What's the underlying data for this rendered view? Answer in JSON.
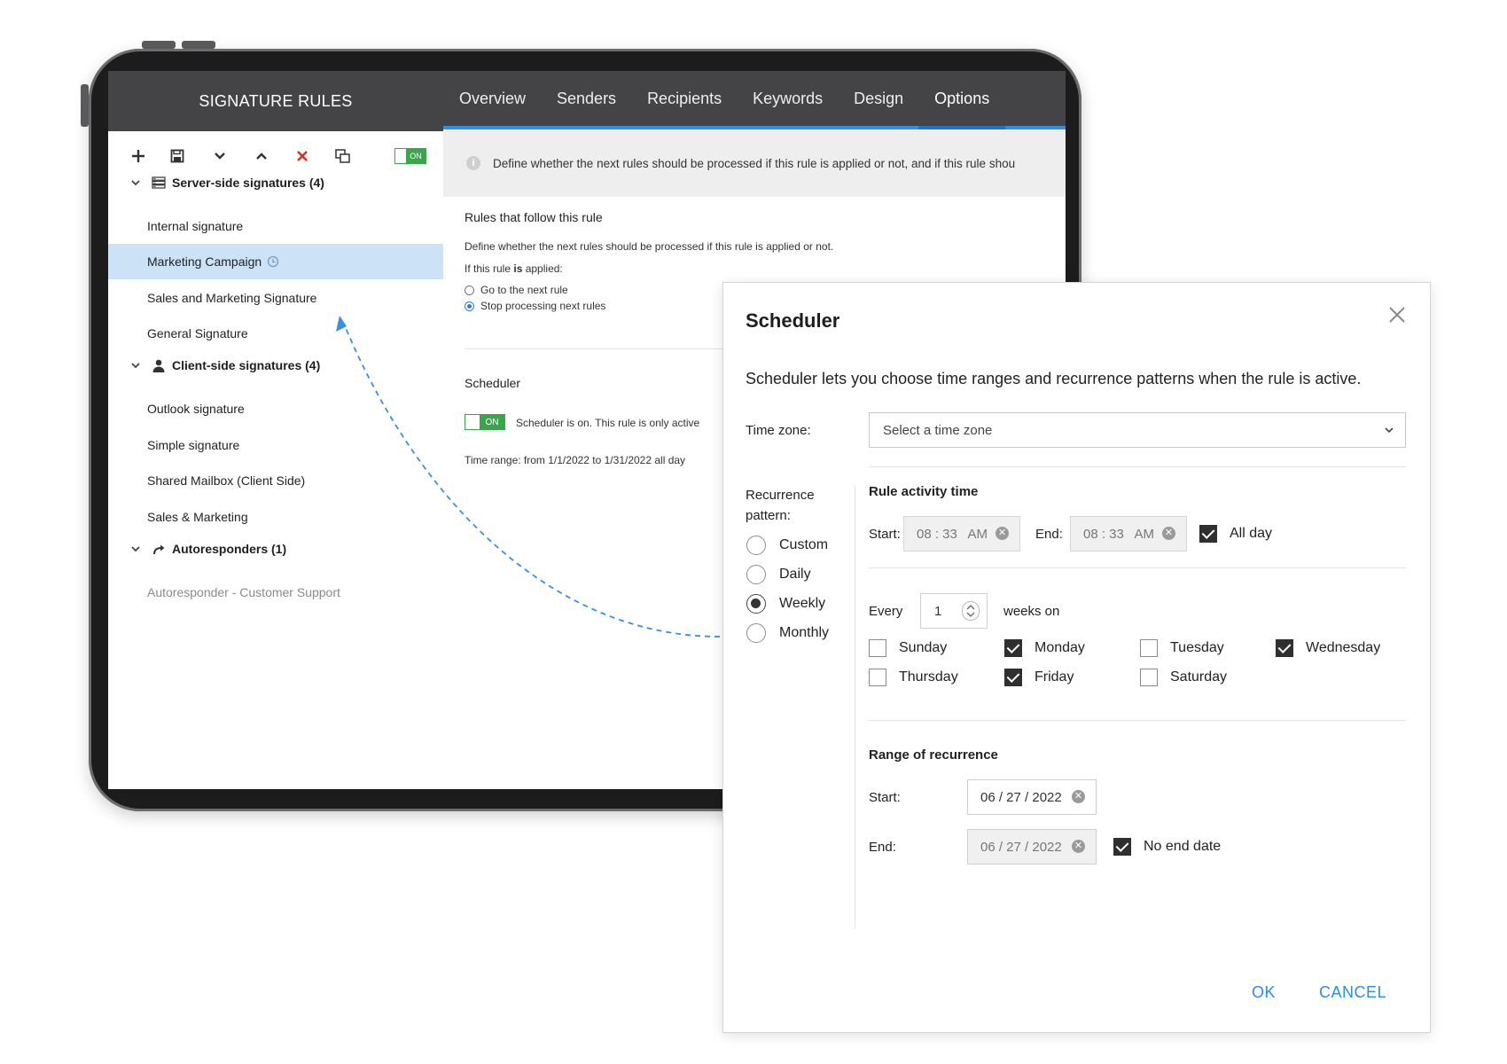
{
  "sidebar": {
    "title": "SIGNATURE RULES",
    "toolbar": {
      "toggle_label": "ON"
    },
    "groups": [
      {
        "label": "Server-side signatures (4)",
        "icon": "server-icon",
        "items": [
          "Internal signature",
          "Marketing Campaign",
          "Sales and Marketing Signature",
          "General Signature"
        ]
      },
      {
        "label": "Client-side signatures (4)",
        "icon": "person-icon",
        "items": [
          "Outlook signature",
          "Simple signature",
          "Shared Mailbox (Client Side)",
          "Sales & Marketing"
        ]
      },
      {
        "label": "Autoresponders (1)",
        "icon": "reply-arrow-icon",
        "items": [
          "Autoresponder - Customer Support"
        ]
      }
    ],
    "selected_item": "Marketing Campaign"
  },
  "tabs": [
    "Overview",
    "Senders",
    "Recipients",
    "Keywords",
    "Design",
    "Options"
  ],
  "active_tab": "Options",
  "options": {
    "info_text": "Define whether the next rules should be processed if this rule is applied or not, and if this rule shou",
    "rules_follow_title": "Rules that follow this rule",
    "rules_follow_desc": "Define whether the next rules should be processed if this rule is applied or not.",
    "if_applied_prefix": "If this rule ",
    "if_applied_bold": "is",
    "if_applied_suffix": " applied:",
    "radio_next": "Go to the next rule",
    "radio_stop": "Stop processing next rules",
    "scheduler_title": "Scheduler",
    "scheduler_toggle": "ON",
    "scheduler_status": "Scheduler is on. This rule is only active",
    "time_range": "Time range: from 1/1/2022 to 1/31/2022 all day"
  },
  "dialog": {
    "title": "Scheduler",
    "description": "Scheduler lets you choose time ranges and recurrence patterns when the rule is active.",
    "timezone_label": "Time zone:",
    "timezone_placeholder": "Select a time zone",
    "recurrence_label_1": "Recurrence",
    "recurrence_label_2": "pattern:",
    "patterns": [
      "Custom",
      "Daily",
      "Weekly",
      "Monthly"
    ],
    "selected_pattern": "Weekly",
    "activity_title": "Rule activity time",
    "start_label": "Start:",
    "end_label": "End:",
    "start_time": "08 : 33   AM",
    "end_time": "08 : 33   AM",
    "all_day_label": "All day",
    "all_day_checked": true,
    "every_label": "Every",
    "every_value": "1",
    "weeks_on_label": "weeks on",
    "days": [
      {
        "name": "Sunday",
        "checked": false
      },
      {
        "name": "Monday",
        "checked": true
      },
      {
        "name": "Tuesday",
        "checked": false
      },
      {
        "name": "Wednesday",
        "checked": true
      },
      {
        "name": "Thursday",
        "checked": false
      },
      {
        "name": "Friday",
        "checked": true
      },
      {
        "name": "Saturday",
        "checked": false
      }
    ],
    "range_title": "Range of recurrence",
    "range_start_label": "Start:",
    "range_end_label": "End:",
    "range_start": "06 / 27 / 2022",
    "range_end": "06 / 27 / 2022",
    "no_end_label": "No end date",
    "no_end_checked": true,
    "ok_label": "OK",
    "cancel_label": "CANCEL"
  },
  "colors": {
    "accent": "#2c8ee3",
    "header_bg": "#444446",
    "selected_row": "#cce2f7",
    "toggle_on": "#3aa64c",
    "delete_red": "#d93025"
  }
}
